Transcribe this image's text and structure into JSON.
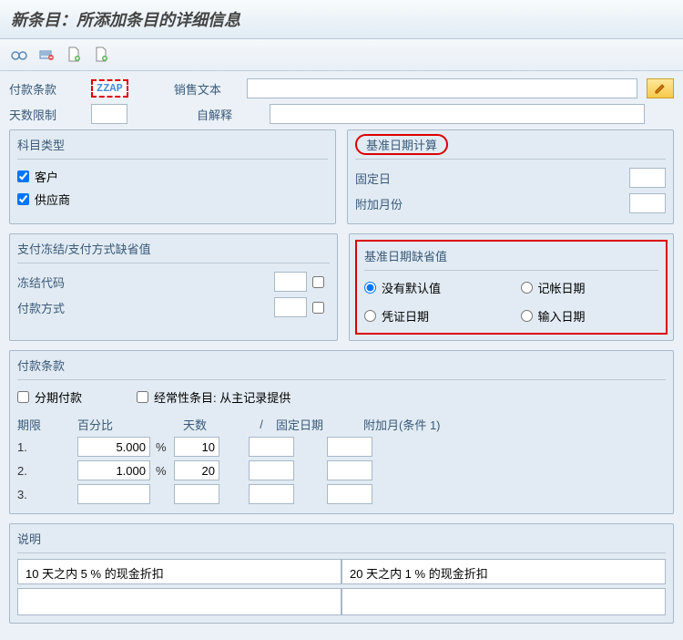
{
  "titlebar": {
    "title": "新条目：所添加条目的详细信息"
  },
  "top": {
    "paymentTermsLabel": "付款条款",
    "paymentTermsCode": "ZZAP",
    "salesTextLabel": "销售文本",
    "salesTextValue": "",
    "dayLimitLabel": "天数限制",
    "dayLimitValue": "",
    "selfExplainLabel": "自解释",
    "selfExplainValue": ""
  },
  "accountType": {
    "title": "科目类型",
    "customer": "客户",
    "vendor": "供应商",
    "customerChecked": true,
    "vendorChecked": true
  },
  "baselineCalc": {
    "title": "基准日期计算",
    "fixedDayLabel": "固定日",
    "fixedDayValue": "",
    "addMonthLabel": "附加月份",
    "addMonthValue": ""
  },
  "blockDefaults": {
    "title": "支付冻结/支付方式缺省值",
    "blockCodeLabel": "冻结代码",
    "blockCodeValue": "",
    "payMethodLabel": "付款方式",
    "payMethodValue": ""
  },
  "baselineDefault": {
    "title": "基准日期缺省值",
    "opt1": "没有默认值",
    "opt2": "记帐日期",
    "opt3": "凭证日期",
    "opt4": "输入日期",
    "selected": "opt1"
  },
  "terms": {
    "title": "付款条款",
    "installmentLabel": "分期付款",
    "recurringLabel": "经常性条目: 从主记录提供",
    "headerPeriod": "期限",
    "headerPct": "百分比",
    "headerDays": "天数",
    "headerSlash": "/",
    "headerFixed": "固定日期",
    "headerAddM": "附加月(条件 1)",
    "rows": [
      {
        "num": "1.",
        "pct": "5.000",
        "days": "10",
        "fixed": "",
        "addm": ""
      },
      {
        "num": "2.",
        "pct": "1.000",
        "days": "20",
        "fixed": "",
        "addm": ""
      },
      {
        "num": "3.",
        "pct": "",
        "days": "",
        "fixed": "",
        "addm": ""
      }
    ],
    "pctSymbol": "%"
  },
  "desc": {
    "title": "说明",
    "line1a": "10 天之内 5 % 的现金折扣",
    "line1b": "20 天之内 1 % 的现金折扣",
    "line2a": "",
    "line2b": ""
  },
  "icons": {
    "glasses": "glasses-icon",
    "rowdel": "row-delete-icon",
    "newdoc": "new-doc-icon",
    "newdoc2": "new-doc-plus-icon",
    "pencil": "pencil-icon"
  }
}
